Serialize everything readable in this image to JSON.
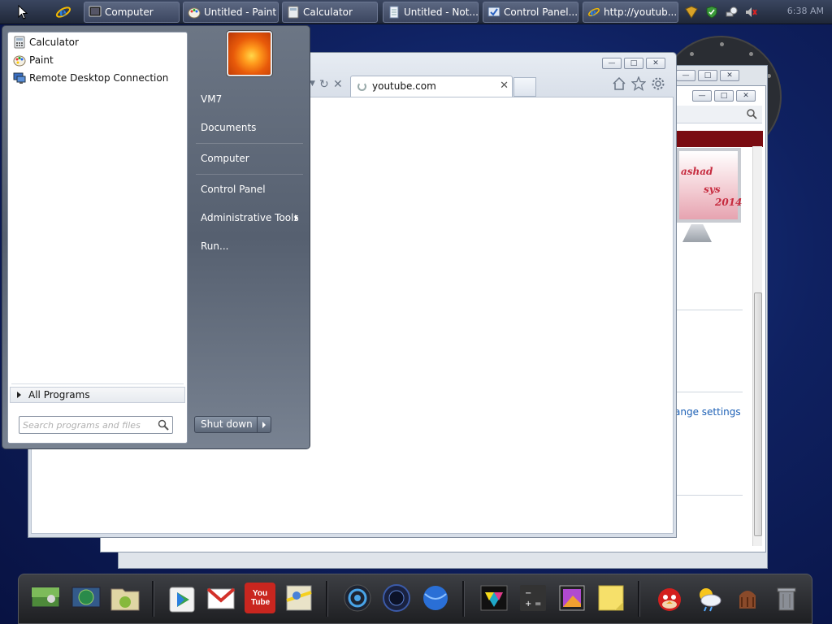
{
  "taskbar": {
    "buttons": [
      {
        "label": "Computer"
      },
      {
        "label": "Untitled - Paint"
      },
      {
        "label": "Calculator"
      },
      {
        "label": "Untitled - Not..."
      },
      {
        "label": "Control Panel..."
      },
      {
        "label": "http://youtub..."
      }
    ],
    "clock": "6:38 AM"
  },
  "browser": {
    "tab_title": "youtube.com"
  },
  "background_window": {
    "link_text": "ange settings",
    "banner_text_1": "ashad",
    "banner_text_2": "sys",
    "banner_text_3": "2014"
  },
  "start_menu": {
    "programs": [
      {
        "label": "Calculator",
        "icon": "calculator-icon"
      },
      {
        "label": "Paint",
        "icon": "paint-icon"
      },
      {
        "label": "Remote Desktop Connection",
        "icon": "remote-desktop-icon"
      }
    ],
    "all_programs": "All Programs",
    "search_placeholder": "Search programs and files",
    "right_items": [
      {
        "label": "VM7"
      },
      {
        "label": "Documents"
      },
      {
        "label": "Computer"
      },
      {
        "label": "Control Panel"
      },
      {
        "label": "Administrative Tools",
        "submenu": true
      },
      {
        "label": "Run..."
      }
    ],
    "shutdown_label": "Shut down"
  },
  "dock": {
    "icons": [
      "desktop-icon",
      "network-icon",
      "android-folder-icon",
      "play-store-icon",
      "gmail-icon",
      "youtube-icon",
      "maps-icon",
      "camera-icon",
      "speaker-icon",
      "browser-globe-icon",
      "media-icon",
      "calculator-icon",
      "photos-icon",
      "notes-icon",
      "angry-birds-icon",
      "weather-icon",
      "android-icon",
      "trash-icon"
    ],
    "youtube_label": "You Tube"
  },
  "colors": {
    "taskbar": "#2a3348",
    "start_menu_right": "#5f6978",
    "link": "#1b5fb5",
    "banner": "#7a0c12"
  }
}
